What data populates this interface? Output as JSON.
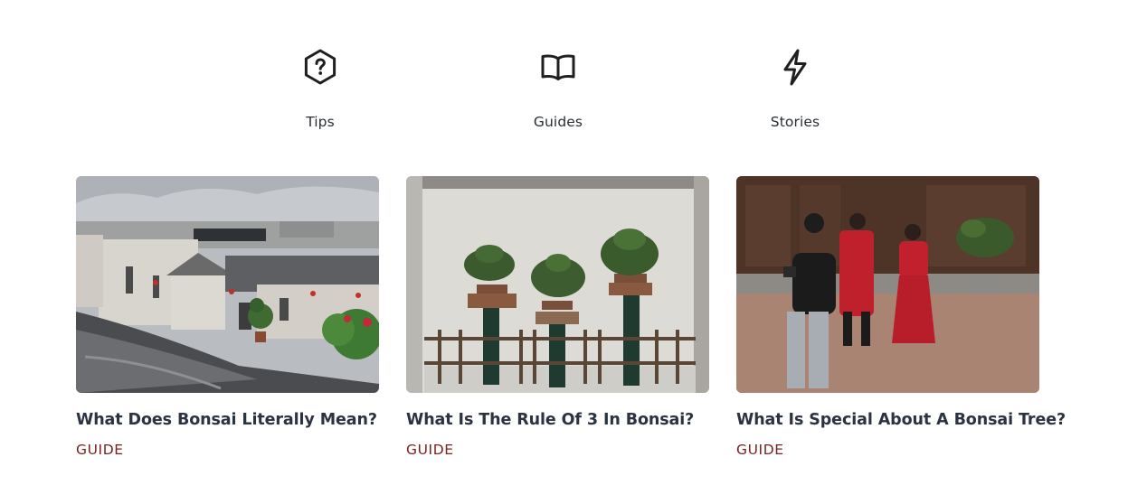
{
  "categories": [
    {
      "label": "Tips",
      "icon": "question-hexagon-icon"
    },
    {
      "label": "Guides",
      "icon": "open-book-icon"
    },
    {
      "label": "Stories",
      "icon": "lightning-bolt-icon"
    }
  ],
  "cards": [
    {
      "title": "What Does Bonsai Literally Mean?",
      "tag": "GUIDE",
      "image": "chinese-village-rooftops-with-bonsai-photo"
    },
    {
      "title": "What Is The Rule Of 3 In Bonsai?",
      "tag": "GUIDE",
      "image": "bonsai-trees-on-pedestals-photo"
    },
    {
      "title": "What Is Special About A Bonsai Tree?",
      "tag": "GUIDE",
      "image": "couple-in-red-photoshoot-courtyard-photo"
    }
  ],
  "colors": {
    "icon": "#1f1f1f",
    "label": "#2a2f36",
    "title": "#2c3340",
    "tag": "#7a1f1f"
  }
}
